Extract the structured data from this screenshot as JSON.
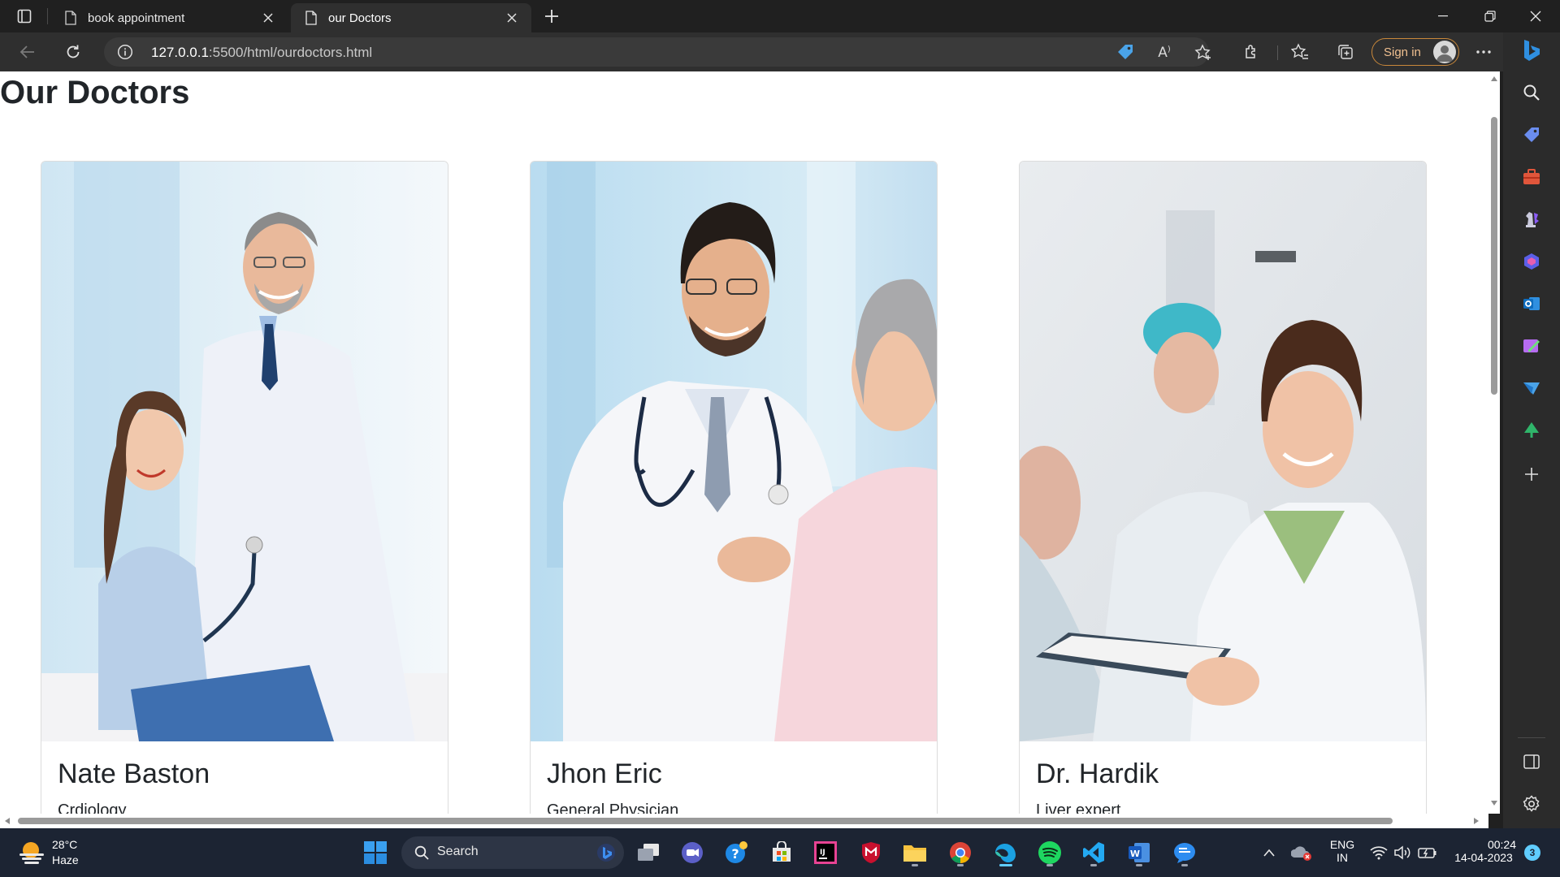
{
  "browser": {
    "tabs": [
      {
        "title": "book appointment",
        "active": false
      },
      {
        "title": "our Doctors",
        "active": true
      }
    ],
    "address": {
      "host": "127.0.0.1",
      "rest": ":5500/html/ourdoctors.html"
    },
    "signin_label": "Sign in"
  },
  "page": {
    "heading": "Our Doctors",
    "doctors": [
      {
        "name": "Nate Baston",
        "specialty": "Crdiology"
      },
      {
        "name": "Jhon Eric",
        "specialty": "General Physician"
      },
      {
        "name": "Dr. Hardik",
        "specialty": "Liver expert"
      }
    ]
  },
  "taskbar": {
    "weather": {
      "temp": "28°C",
      "condition": "Haze"
    },
    "search_label": "Search",
    "language": {
      "line1": "ENG",
      "line2": "IN"
    },
    "clock": {
      "time": "00:24",
      "date": "14-04-2023"
    },
    "notification_count": "3"
  },
  "colors": {
    "accent": "#c9883a",
    "taskbar": "#1c2433",
    "chrome": "#202020"
  }
}
